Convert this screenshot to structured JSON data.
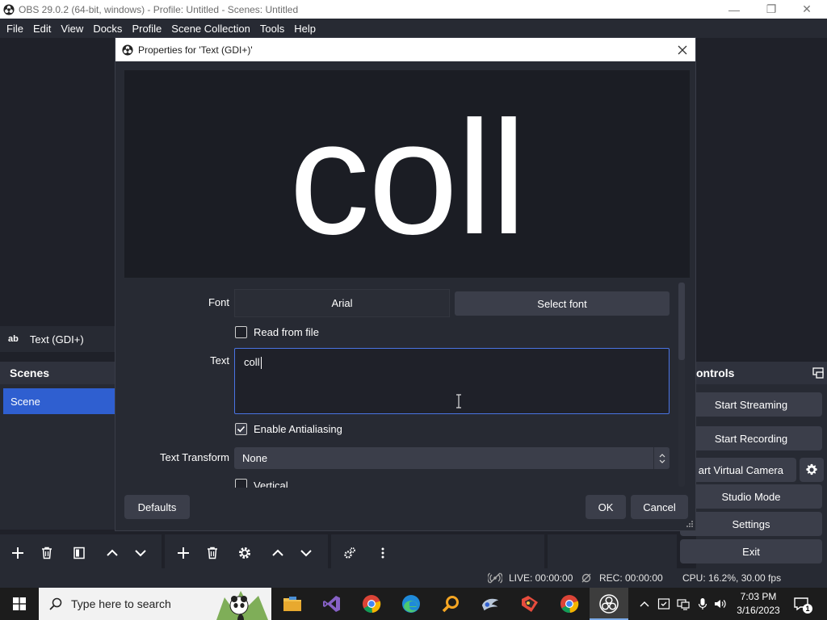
{
  "window": {
    "title": "OBS 29.0.2 (64-bit, windows) - Profile: Untitled - Scenes: Untitled",
    "minimize": "—",
    "restore": "❐",
    "close": "✕"
  },
  "menu": [
    "File",
    "Edit",
    "View",
    "Docks",
    "Profile",
    "Scene Collection",
    "Tools",
    "Help"
  ],
  "sources": {
    "item_icon": "ab",
    "item_label": "Text (GDI+)"
  },
  "scenes": {
    "header": "Scenes",
    "items": [
      "Scene"
    ]
  },
  "controls": {
    "header": "ontrols",
    "start_streaming": "Start Streaming",
    "start_recording": "Start Recording",
    "start_virtual_camera": "art Virtual Camera",
    "studio_mode": "Studio Mode",
    "settings": "Settings",
    "exit": "Exit"
  },
  "status": {
    "live": "LIVE: 00:00:00",
    "rec": "REC: 00:00:00",
    "cpu": "CPU: 16.2%, 30.00 fps"
  },
  "dialog": {
    "title": "Properties for 'Text (GDI+)'",
    "preview_text": "coll",
    "font_label": "Font",
    "font_value": "Arial",
    "select_font": "Select font",
    "read_from_file": "Read from file",
    "read_from_file_checked": false,
    "text_label": "Text",
    "text_value": "coll",
    "enable_antialiasing": "Enable Antialiasing",
    "enable_antialiasing_checked": true,
    "text_transform_label": "Text Transform",
    "text_transform_value": "None",
    "vertical": "Vertical",
    "defaults_button": "Defaults",
    "ok_button": "OK",
    "cancel_button": "Cancel"
  },
  "taskbar": {
    "search_placeholder": "Type here to search",
    "clock_time": "7:03 PM",
    "clock_date": "3/16/2023",
    "notification_count": "1"
  },
  "colors": {
    "accent": "#2f5fd0",
    "focus_border": "#4a74e4",
    "panel": "#272a33",
    "button": "#3b3e4a"
  }
}
